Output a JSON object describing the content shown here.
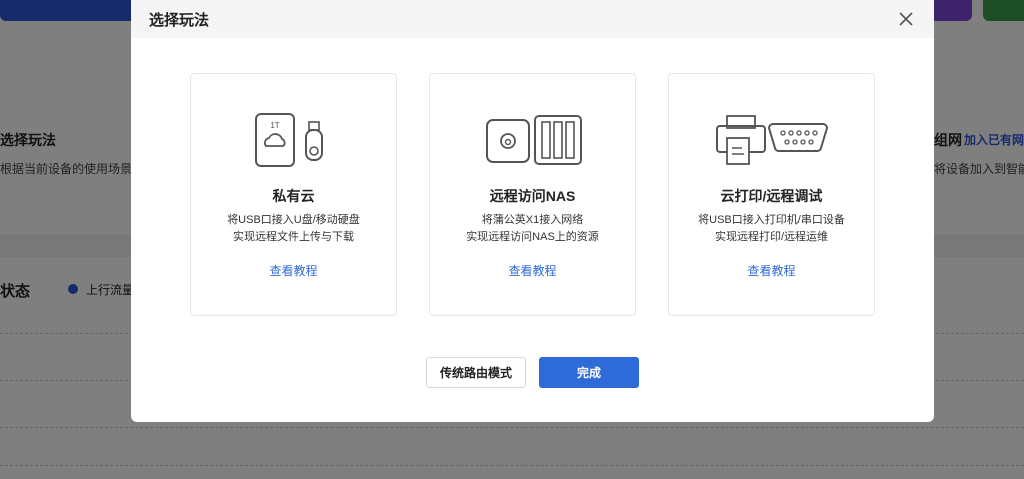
{
  "background": {
    "section1_title": "选择玩法",
    "section1_desc": "根据当前设备的使用场景选",
    "section2_title": "组网",
    "section2_link": "加入已有网",
    "section2_desc": "将设备加入到智能",
    "status_title": "状态",
    "legend_upload": "上行流量",
    "colors": {
      "blue": "#1f3f9a",
      "purple": "#6a3cc0",
      "green": "#2f7a3a",
      "legend": "#2255cc"
    }
  },
  "modal": {
    "title": "选择玩法",
    "cards": [
      {
        "title": "私有云",
        "desc1": "将USB口接入U盘/移动硬盘",
        "desc2": "实现远程文件上传与下载",
        "link": "查看教程",
        "icon_label": "1T"
      },
      {
        "title": "远程访问NAS",
        "desc1": "将蒲公英X1接入网络",
        "desc2": "实现远程访问NAS上的资源",
        "link": "查看教程"
      },
      {
        "title": "云打印/远程调试",
        "desc1": "将USB口接入打印机/串口设备",
        "desc2": "实现远程打印/远程运维",
        "link": "查看教程"
      }
    ],
    "secondary_button": "传统路由模式",
    "primary_button": "完成",
    "accent": "#2f6bd8"
  }
}
